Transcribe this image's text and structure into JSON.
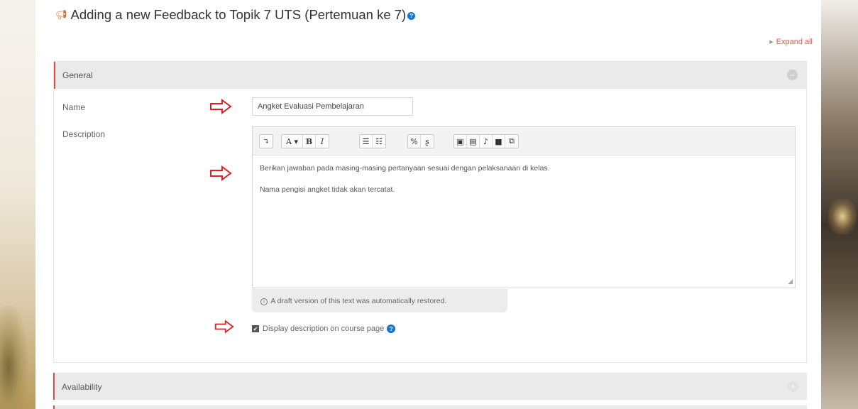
{
  "page": {
    "title": "Adding a new Feedback to Topik 7 UTS (Pertemuan ke 7)",
    "title_icon": "megaphone-icon",
    "help_icon": "question-circle-icon",
    "expand_all_label": "Expand all"
  },
  "general": {
    "header": "General",
    "name_label": "Name",
    "name_value": "Angket Evaluasi Pembelajaran",
    "description_label": "Description",
    "toolbar_buttons": [
      {
        "icon": "toggle-toolbar-icon",
        "glyph": "↴"
      },
      {
        "icon": "font-style-icon",
        "glyph": "A ▾"
      },
      {
        "icon": "bold-icon",
        "glyph": "B"
      },
      {
        "icon": "italic-icon",
        "glyph": "I"
      },
      {
        "icon": "unordered-list-icon",
        "glyph": "☰"
      },
      {
        "icon": "ordered-list-icon",
        "glyph": "☷"
      },
      {
        "icon": "link-icon",
        "glyph": "%"
      },
      {
        "icon": "unlink-icon",
        "glyph": "ʂ"
      },
      {
        "icon": "image-icon",
        "glyph": "▣"
      },
      {
        "icon": "media-icon",
        "glyph": "▤"
      },
      {
        "icon": "record-audio-icon",
        "glyph": "♪"
      },
      {
        "icon": "record-video-icon",
        "glyph": "■"
      },
      {
        "icon": "manage-files-icon",
        "glyph": "⧉"
      }
    ],
    "description_paragraphs": [
      "Berikan jawaban pada masing-masing pertanyaan sesuai dengan pelaksanaan di kelas.",
      "Nama pengisi angket tidak akan tercatat."
    ],
    "restore_note": "A draft version of this text was automatically restored.",
    "display_description_label": "Display description on course page",
    "display_description_checked": true
  },
  "availability": {
    "header": "Availability"
  },
  "colors": {
    "accent_red": "#e14b4b",
    "help_blue": "#1177d1",
    "arrow_red": "#e02020"
  }
}
